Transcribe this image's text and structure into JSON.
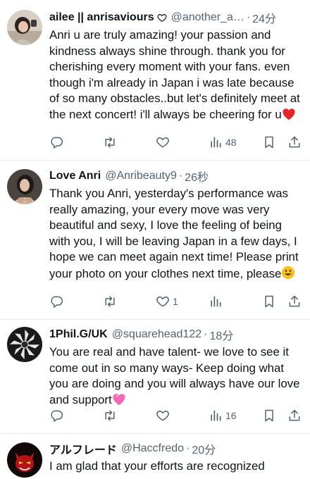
{
  "tweets": [
    {
      "name": "ailee || anrisaviours",
      "handle": "@another_a…",
      "time": "24分",
      "text": "Anri u are truly amazing! your passion and kindness always shine through. thank you for cherishing every moment with your fans. even though i'm already in Japan i was late because of so many obstacles..but let's definitely meet at the next concert! i'll always be cheering for u",
      "emoji": "red-heart",
      "views": "48",
      "likes": ""
    },
    {
      "name": "Love Anri",
      "handle": "@Anribeauty9",
      "time": "26秒",
      "text": "Thank you Anri, yesterday's performance was really amazing, your every move was very beautiful and sexy, I love the feeling of being with you, I will be leaving Japan in a few days, I hope we can meet again next time! Please print your photo on your clothes next time, please",
      "emoji": "smiley",
      "views": "",
      "likes": "1"
    },
    {
      "name": "1Phil.G/UK",
      "handle": "@squarehead122",
      "time": "18分",
      "text": "You are real and have talent- we love to see it come out in so many ways- Keep doing what you are doing and you will always have our love and support",
      "emoji": "pink-heart",
      "views": "16",
      "likes": ""
    },
    {
      "name": "アルフレード",
      "handle": "@Haccfredo",
      "time": "20分",
      "text": "I am glad that your efforts are recognized"
    }
  ],
  "dot": "·",
  "colors": {
    "text": "#0f1419",
    "muted": "#536471",
    "divider": "#e6ecf0"
  }
}
